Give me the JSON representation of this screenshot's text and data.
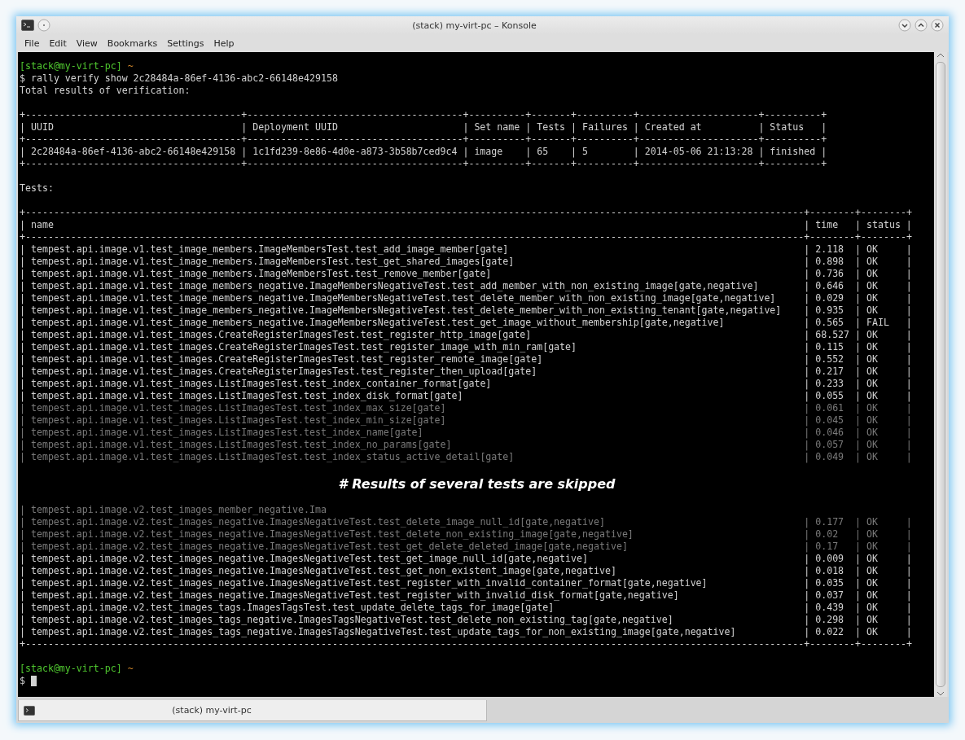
{
  "window": {
    "title": "(stack) my-virt-pc – Konsole"
  },
  "menu": [
    {
      "label": "File"
    },
    {
      "label": "Edit"
    },
    {
      "label": "View"
    },
    {
      "label": "Bookmarks"
    },
    {
      "label": "Settings"
    },
    {
      "label": "Help"
    }
  ],
  "terminal": {
    "prompt": {
      "user_host": "[stack@my-virt-pc]",
      "path": "~"
    },
    "command": "$ rally verify show 2c28484a-86ef-4136-abc2-66148e429158",
    "summary_heading": "Total results of verification:",
    "border": {
      "corner": "+",
      "rule": "-",
      "separator": "|"
    },
    "summary_table": {
      "columns": [
        "UUID",
        "Deployment UUID",
        "Set name",
        "Tests",
        "Failures",
        "Created at",
        "Status"
      ],
      "rows": [
        [
          "2c28484a-86ef-4136-abc2-66148e429158",
          "1c1fd239-8e86-4d0e-a873-3b58b7ced9c4",
          "image",
          "65",
          "5",
          "2014-05-06 21:13:28",
          "finished"
        ]
      ]
    },
    "tests_heading": "Tests:",
    "tests_table": {
      "columns": [
        "name",
        "time",
        "status"
      ],
      "rows_top": [
        {
          "name": "tempest.api.image.v1.test_image_members.ImageMembersTest.test_add_image_member[gate]",
          "time": "2.118",
          "status": "OK",
          "faded": false
        },
        {
          "name": "tempest.api.image.v1.test_image_members.ImageMembersTest.test_get_shared_images[gate]",
          "time": "0.898",
          "status": "OK",
          "faded": false
        },
        {
          "name": "tempest.api.image.v1.test_image_members.ImageMembersTest.test_remove_member[gate]",
          "time": "0.736",
          "status": "OK",
          "faded": false
        },
        {
          "name": "tempest.api.image.v1.test_image_members_negative.ImageMembersNegativeTest.test_add_member_with_non_existing_image[gate,negative]",
          "time": "0.646",
          "status": "OK",
          "faded": false
        },
        {
          "name": "tempest.api.image.v1.test_image_members_negative.ImageMembersNegativeTest.test_delete_member_with_non_existing_image[gate,negative]",
          "time": "0.029",
          "status": "OK",
          "faded": false
        },
        {
          "name": "tempest.api.image.v1.test_image_members_negative.ImageMembersNegativeTest.test_delete_member_with_non_existing_tenant[gate,negative]",
          "time": "0.935",
          "status": "OK",
          "faded": false
        },
        {
          "name": "tempest.api.image.v1.test_image_members_negative.ImageMembersNegativeTest.test_get_image_without_membership[gate,negative]",
          "time": "0.565",
          "status": "FAIL",
          "faded": false
        },
        {
          "name": "tempest.api.image.v1.test_images.CreateRegisterImagesTest.test_register_http_image[gate]",
          "time": "68.527",
          "status": "OK",
          "faded": false
        },
        {
          "name": "tempest.api.image.v1.test_images.CreateRegisterImagesTest.test_register_image_with_min_ram[gate]",
          "time": "0.115",
          "status": "OK",
          "faded": false
        },
        {
          "name": "tempest.api.image.v1.test_images.CreateRegisterImagesTest.test_register_remote_image[gate]",
          "time": "0.552",
          "status": "OK",
          "faded": false
        },
        {
          "name": "tempest.api.image.v1.test_images.CreateRegisterImagesTest.test_register_then_upload[gate]",
          "time": "0.217",
          "status": "OK",
          "faded": false
        },
        {
          "name": "tempest.api.image.v1.test_images.ListImagesTest.test_index_container_format[gate]",
          "time": "0.233",
          "status": "OK",
          "faded": false
        },
        {
          "name": "tempest.api.image.v1.test_images.ListImagesTest.test_index_disk_format[gate]",
          "time": "0.055",
          "status": "OK",
          "faded": false
        },
        {
          "name": "tempest.api.image.v1.test_images.ListImagesTest.test_index_max_size[gate]",
          "time": "0.061",
          "status": "OK",
          "faded": true
        },
        {
          "name": "tempest.api.image.v1.test_images.ListImagesTest.test_index_min_size[gate]",
          "time": "0.045",
          "status": "OK",
          "faded": true
        },
        {
          "name": "tempest.api.image.v1.test_images.ListImagesTest.test_index_name[gate]",
          "time": "0.046",
          "status": "OK",
          "faded": true
        },
        {
          "name": "tempest.api.image.v1.test_images.ListImagesTest.test_index_no_params[gate]",
          "time": "0.057",
          "status": "OK",
          "faded": true
        },
        {
          "name": "tempest.api.image.v1.test_images.ListImagesTest.test_index_status_active_detail[gate]",
          "time": "0.049",
          "status": "OK",
          "faded": true
        }
      ],
      "note": "# Results of several tests are skipped",
      "rows_bottom": [
        {
          "name": "tempest.api.image.v2.test_images_member_negative.Ima",
          "faded": true
        },
        {
          "name": "tempest.api.image.v2.test_images_negative.ImagesNegativeTest.test_delete_image_null_id[gate,negative]",
          "time": "0.177",
          "status": "OK",
          "faded": true
        },
        {
          "name": "tempest.api.image.v2.test_images_negative.ImagesNegativeTest.test_delete_non_existing_image[gate,negative]",
          "time": "0.02",
          "status": "OK",
          "faded": true
        },
        {
          "name": "tempest.api.image.v2.test_images_negative.ImagesNegativeTest.test_get_delete_deleted_image[gate,negative]",
          "time": "0.17",
          "status": "OK",
          "faded": true
        },
        {
          "name": "tempest.api.image.v2.test_images_negative.ImagesNegativeTest.test_get_image_null_id[gate,negative]",
          "time": "0.009",
          "status": "OK",
          "faded": false
        },
        {
          "name": "tempest.api.image.v2.test_images_negative.ImagesNegativeTest.test_get_non_existent_image[gate,negative]",
          "time": "0.018",
          "status": "OK",
          "faded": false
        },
        {
          "name": "tempest.api.image.v2.test_images_negative.ImagesNegativeTest.test_register_with_invalid_container_format[gate,negative]",
          "time": "0.035",
          "status": "OK",
          "faded": false
        },
        {
          "name": "tempest.api.image.v2.test_images_negative.ImagesNegativeTest.test_register_with_invalid_disk_format[gate,negative]",
          "time": "0.037",
          "status": "OK",
          "faded": false
        },
        {
          "name": "tempest.api.image.v2.test_images_tags.ImagesTagsTest.test_update_delete_tags_for_image[gate]",
          "time": "0.439",
          "status": "OK",
          "faded": false
        },
        {
          "name": "tempest.api.image.v2.test_images_tags_negative.ImagesTagsNegativeTest.test_delete_non_existing_tag[gate,negative]",
          "time": "0.298",
          "status": "OK",
          "faded": false
        },
        {
          "name": "tempest.api.image.v2.test_images_tags_negative.ImagesTagsNegativeTest.test_update_tags_for_non_existing_image[gate,negative]",
          "time": "0.022",
          "status": "OK",
          "faded": false
        }
      ]
    },
    "final_prompt": {
      "user_host": "[stack@my-virt-pc]",
      "path": "~"
    },
    "input_line": "$"
  },
  "tabs": [
    {
      "label": "(stack) my-virt-pc",
      "selected": true
    }
  ]
}
